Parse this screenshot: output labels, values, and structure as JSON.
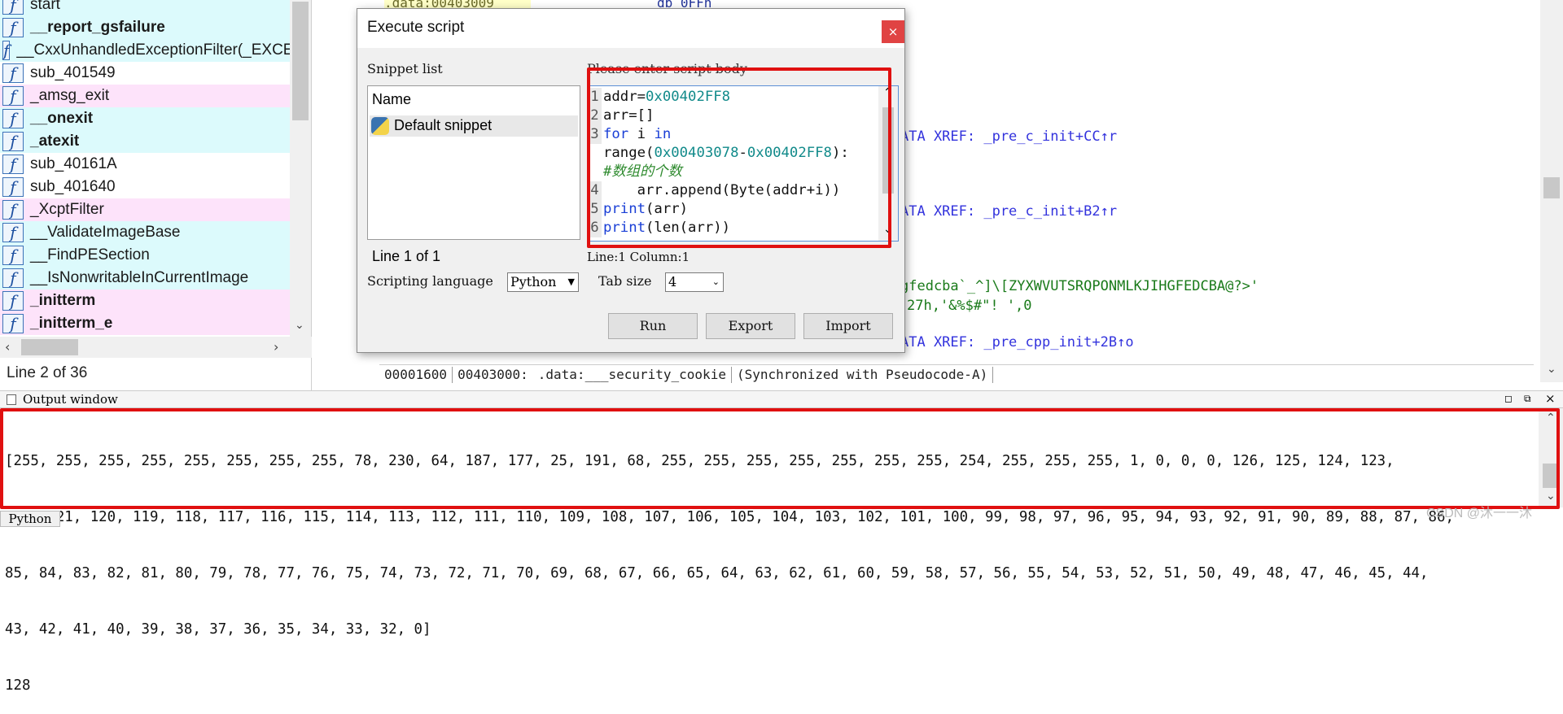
{
  "functions": {
    "items": [
      {
        "name": "start",
        "bold": false,
        "tint": "cyan"
      },
      {
        "name": "__report_gsfailure",
        "bold": true,
        "tint": "cyan"
      },
      {
        "name": "__CxxUnhandledExceptionFilter(_EXCE",
        "bold": false,
        "tint": "cyan"
      },
      {
        "name": "sub_401549",
        "bold": false,
        "tint": "none"
      },
      {
        "name": "_amsg_exit",
        "bold": false,
        "tint": "pink"
      },
      {
        "name": "__onexit",
        "bold": true,
        "tint": "cyan"
      },
      {
        "name": "_atexit",
        "bold": true,
        "tint": "cyan"
      },
      {
        "name": "sub_40161A",
        "bold": false,
        "tint": "none"
      },
      {
        "name": "sub_401640",
        "bold": false,
        "tint": "none"
      },
      {
        "name": "_XcptFilter",
        "bold": false,
        "tint": "pink"
      },
      {
        "name": "__ValidateImageBase",
        "bold": false,
        "tint": "cyan"
      },
      {
        "name": "__FindPESection",
        "bold": false,
        "tint": "cyan"
      },
      {
        "name": "__IsNonwritableInCurrentImage",
        "bold": false,
        "tint": "cyan"
      },
      {
        "name": "_initterm",
        "bold": true,
        "tint": "pink"
      },
      {
        "name": "_initterm_e",
        "bold": true,
        "tint": "pink"
      }
    ],
    "icon_glyph": "f",
    "status": "Line 2 of 36"
  },
  "disasm": {
    "top_line": ".data:00403009",
    "top_instr": "db 0FFh",
    "xrefs": [
      "ATA XREF: _pre_c_init+CC↑r",
      "ATA XREF: _pre_c_init+B2↑r",
      "ATA XREF: _pre_cpp_init+2B↑o"
    ],
    "strings": [
      "gfedcba`_^]\\[ZYXWVUTSRQPONMLKJIHGFEDCBA@?>'",
      "27h,'&%$#\"! ',0"
    ],
    "status": {
      "offset": "00001600",
      "address": "00403000:",
      "text": ".data:___security_cookie",
      "sync": "(Synchronized with Pseudocode-A)"
    }
  },
  "dialog": {
    "title": "Execute script",
    "close_glyph": "×",
    "snippet_list_label": "Snippet list",
    "snippet_header": "Name",
    "snippet_item": "Default snippet",
    "snippet_status": "Line 1 of 1",
    "body_label": "Please enter script body",
    "editor_status": "Line:1  Column:1",
    "scripting_language_label": "Scripting language",
    "scripting_language_value": "Python",
    "tab_size_label": "Tab size",
    "tab_size_value": "4",
    "run_label": "Run",
    "export_label": "Export",
    "import_label": "Import",
    "code": [
      {
        "gutter": "1",
        "parts": [
          {
            "c": "df",
            "t": "addr="
          },
          {
            "c": "num",
            "t": "0x00402FF8"
          }
        ]
      },
      {
        "gutter": "2",
        "parts": [
          {
            "c": "df",
            "t": "arr=[]"
          }
        ]
      },
      {
        "gutter": "3",
        "parts": [
          {
            "c": "kw",
            "t": "for"
          },
          {
            "c": "df",
            "t": " i "
          },
          {
            "c": "kw",
            "t": "in"
          }
        ]
      },
      {
        "gutter": "",
        "parts": [
          {
            "c": "df",
            "t": "range("
          },
          {
            "c": "num",
            "t": "0x00403078"
          },
          {
            "c": "df",
            "t": "-"
          },
          {
            "c": "num",
            "t": "0x00402FF8"
          },
          {
            "c": "df",
            "t": "):"
          }
        ]
      },
      {
        "gutter": "",
        "parts": [
          {
            "c": "cm",
            "t": "#数组的个数"
          }
        ]
      },
      {
        "gutter": "4",
        "parts": [
          {
            "c": "df",
            "t": "    arr.append(Byte(addr+i))"
          }
        ]
      },
      {
        "gutter": "5",
        "parts": [
          {
            "c": "kw",
            "t": "print"
          },
          {
            "c": "df",
            "t": "(arr)"
          }
        ]
      },
      {
        "gutter": "6",
        "parts": [
          {
            "c": "kw",
            "t": "print"
          },
          {
            "c": "df",
            "t": "(len(arr))"
          }
        ]
      }
    ]
  },
  "output": {
    "title": "Output window",
    "lines": [
      "[255, 255, 255, 255, 255, 255, 255, 255, 78, 230, 64, 187, 177, 25, 191, 68, 255, 255, 255, 255, 255, 255, 255, 254, 255, 255, 255, 1, 0, 0, 0, 126, 125, 124, 123,",
      "122, 121, 120, 119, 118, 117, 116, 115, 114, 113, 112, 111, 110, 109, 108, 107, 106, 105, 104, 103, 102, 101, 100, 99, 98, 97, 96, 95, 94, 93, 92, 91, 90, 89, 88, 87, 86,",
      "85, 84, 83, 82, 81, 80, 79, 78, 77, 76, 75, 74, 73, 72, 71, 70, 69, 68, 67, 66, 65, 64, 63, 62, 61, 60, 59, 58, 57, 56, 55, 54, 53, 52, 51, 50, 49, 48, 47, 46, 45, 44,",
      "43, 42, 41, 40, 39, 38, 37, 36, 35, 34, 33, 32, 0]",
      "128"
    ],
    "tab": "Python"
  },
  "watermark": "CSDN @沐一一沐",
  "colors": {
    "highlight": "#e01010",
    "cyan_row": "#dcfafc",
    "pink_row": "#fde3fa",
    "keyword": "#1a3fd6",
    "number": "#118a8a",
    "comment": "#2e8a2e"
  }
}
